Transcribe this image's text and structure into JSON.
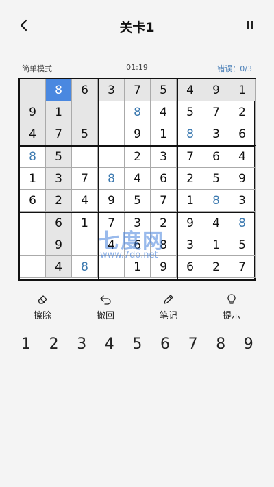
{
  "header": {
    "title": "关卡1"
  },
  "status": {
    "mode": "简单模式",
    "timer": "01:19",
    "errors": "错误：0/3"
  },
  "board": {
    "cells": [
      [
        "",
        "8",
        "6",
        "3",
        "7",
        "5",
        "4",
        "9",
        "1"
      ],
      [
        "9",
        "1",
        "",
        "",
        "8",
        "4",
        "5",
        "7",
        "2"
      ],
      [
        "4",
        "7",
        "5",
        "",
        "9",
        "1",
        "8",
        "3",
        "6"
      ],
      [
        "8",
        "5",
        "",
        "",
        "2",
        "3",
        "7",
        "6",
        "4"
      ],
      [
        "1",
        "3",
        "7",
        "8",
        "4",
        "6",
        "2",
        "5",
        "9"
      ],
      [
        "6",
        "2",
        "4",
        "9",
        "5",
        "7",
        "1",
        "8",
        "3"
      ],
      [
        "",
        "6",
        "1",
        "7",
        "3",
        "2",
        "9",
        "4",
        "8"
      ],
      [
        "",
        "9",
        "",
        "4",
        "6",
        "8",
        "3",
        "1",
        "5"
      ],
      [
        "",
        "4",
        "8",
        "",
        "1",
        "9",
        "6",
        "2",
        "7"
      ]
    ],
    "user_entered": [
      [
        1,
        4
      ],
      [
        2,
        6
      ],
      [
        3,
        0
      ],
      [
        4,
        3
      ],
      [
        5,
        7
      ],
      [
        6,
        8
      ],
      [
        8,
        2
      ]
    ],
    "selected": [
      0,
      1
    ],
    "selected_color": "#4a88e0",
    "user_color": "#3d7ab0",
    "highlight_color": "#e6e6e6"
  },
  "watermark": {
    "big": "七度网",
    "small": "www.7do.net"
  },
  "tools": [
    {
      "icon": "eraser-icon",
      "label": "擦除"
    },
    {
      "icon": "undo-icon",
      "label": "撤回"
    },
    {
      "icon": "pencil-icon",
      "label": "笔记"
    },
    {
      "icon": "lightbulb-icon",
      "label": "提示"
    }
  ],
  "numpad": [
    "1",
    "2",
    "3",
    "4",
    "5",
    "6",
    "7",
    "8",
    "9"
  ]
}
